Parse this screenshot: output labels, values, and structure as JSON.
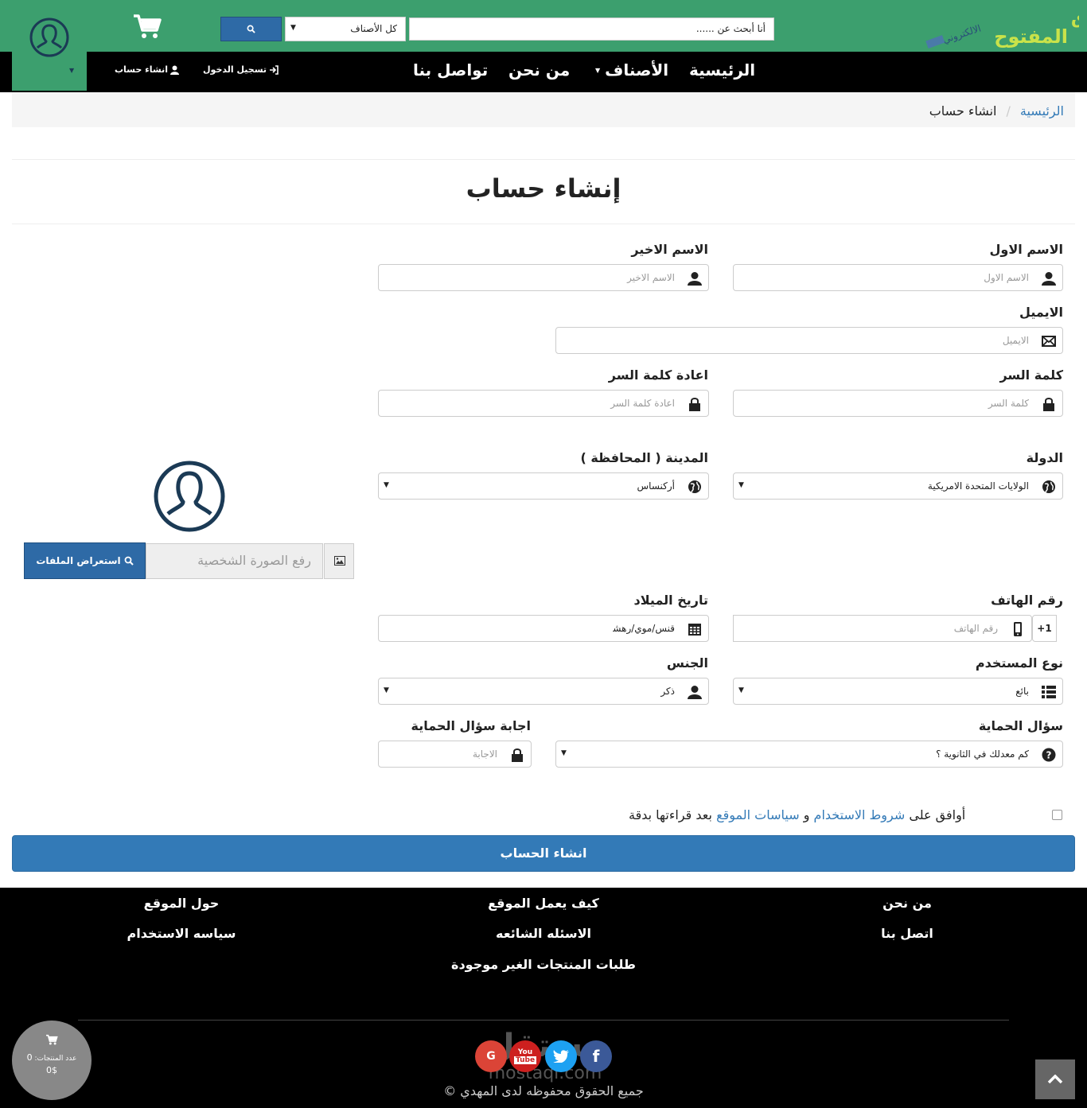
{
  "header": {
    "search_placeholder": "أنا أبحث عن ......",
    "category_selected": "كل الأصناف"
  },
  "nav": {
    "items": [
      "الرئيسية",
      "الأصناف",
      "من نحن",
      "تواصل بنا"
    ],
    "login": "تسجيل الدخول",
    "register": "انشاء حساب"
  },
  "breadcrumb": {
    "home": "الرئيسية",
    "current": "انشاء حساب"
  },
  "page_title": "إنشاء حساب",
  "form": {
    "first_name": {
      "label": "الاسم الاول",
      "placeholder": "الاسم الاول"
    },
    "last_name": {
      "label": "الاسم الاخير",
      "placeholder": "الاسم الاخير"
    },
    "email": {
      "label": "الايميل",
      "placeholder": "الايميل"
    },
    "password": {
      "label": "كلمة السر",
      "placeholder": "كلمة السر"
    },
    "password_confirm": {
      "label": "اعادة كلمة السر",
      "placeholder": "اعادة كلمة السر"
    },
    "country": {
      "label": "الدولة",
      "value": "الولايات المتحدة الامريكية"
    },
    "city": {
      "label": "المدينة ( المحافظة )",
      "value": "أركنساس"
    },
    "phone": {
      "label": "رقم الهاتف",
      "placeholder": "رقم الهاتف",
      "prefix": "+1"
    },
    "birthdate": {
      "label": "تاريخ الميلاد",
      "value": "ﻗﻨﺲ/ﻣﻮﻱ/ﺭﻫﺸ"
    },
    "user_type": {
      "label": "نوع المستخدم",
      "value": "بائع"
    },
    "gender": {
      "label": "الجنس",
      "value": "ذكر"
    },
    "security_question": {
      "label": "سؤال الحماية",
      "value": "كم معدلك في الثانوية ؟"
    },
    "security_answer": {
      "label": "اجابة سؤال الحماية",
      "placeholder": "الاجابة"
    },
    "photo_placeholder": "رفع الصورة الشخصية",
    "browse_label": "استعراض الملفات",
    "terms_prefix": "أوافق على",
    "terms_link": "شروط الاستخدام",
    "terms_and": "و",
    "policy_link": "سياسات الموقع",
    "terms_suffix": "بعد قراءتها بدقة",
    "submit_label": "انشاء الحساب"
  },
  "footer": {
    "links": [
      "من نحن",
      "كيف يعمل الموقع",
      "حول الموقع",
      "اتصل بنا",
      "الاسئله الشائعه",
      "سياسه الاستخدام",
      "طلبات المنتجات الغير موجودة"
    ],
    "copyright": "جميع الحقوق محفوظه لدى المهدي ©",
    "watermark": "mostaql.com",
    "cart_count_label": "عدد المنتجات:",
    "cart_count": "0",
    "cart_total": "0$"
  },
  "colors": {
    "brand_green": "#3c9f6e",
    "primary_blue": "#337ab7",
    "nav_black": "#000000"
  },
  "social": [
    "google-icon",
    "youtube-icon",
    "twitter-icon",
    "facebook-icon"
  ]
}
